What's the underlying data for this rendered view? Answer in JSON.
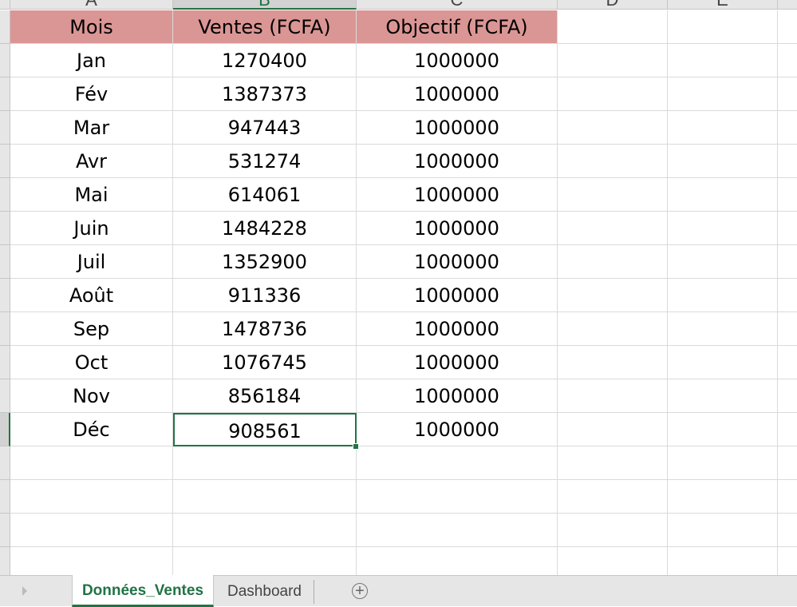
{
  "columns": [
    "A",
    "B",
    "C",
    "D",
    "E"
  ],
  "selected_column": "B",
  "table": {
    "headers": [
      "Mois",
      "Ventes (FCFA)",
      "Objectif (FCFA)"
    ],
    "rows": [
      [
        "Jan",
        "1270400",
        "1000000"
      ],
      [
        "Fév",
        "1387373",
        "1000000"
      ],
      [
        "Mar",
        "947443",
        "1000000"
      ],
      [
        "Avr",
        "531274",
        "1000000"
      ],
      [
        "Mai",
        "614061",
        "1000000"
      ],
      [
        "Juin",
        "1484228",
        "1000000"
      ],
      [
        "Juil",
        "1352900",
        "1000000"
      ],
      [
        "Août",
        "911336",
        "1000000"
      ],
      [
        "Sep",
        "1478736",
        "1000000"
      ],
      [
        "Oct",
        "1076745",
        "1000000"
      ],
      [
        "Nov",
        "856184",
        "1000000"
      ],
      [
        "Déc",
        "908561",
        "1000000"
      ]
    ]
  },
  "active_cell": "B13",
  "sheet_tabs": {
    "active": "Données_Ventes",
    "other": "Dashboard",
    "add_icon": "plus-circle-icon"
  },
  "colors": {
    "header_fill": "#da9694",
    "accent": "#217346"
  }
}
